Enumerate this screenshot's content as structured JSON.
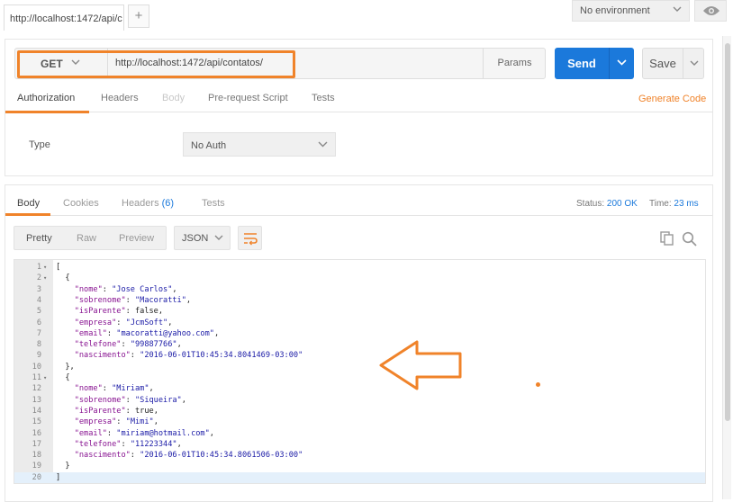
{
  "tabs": {
    "active_label": "http://localhost:1472/api/c",
    "add_label": "+"
  },
  "environment": {
    "selected": "No environment"
  },
  "request": {
    "method": "GET",
    "url": "http://localhost:1472/api/contatos/",
    "params_label": "Params",
    "send_label": "Send",
    "save_label": "Save",
    "tabs": [
      "Authorization",
      "Headers",
      "Body",
      "Pre-request Script",
      "Tests"
    ],
    "generate_code_label": "Generate Code",
    "auth": {
      "type_label": "Type",
      "selected": "No Auth"
    }
  },
  "response": {
    "tabs": {
      "body": "Body",
      "cookies": "Cookies",
      "headers": "Headers",
      "headers_count": "(6)",
      "tests": "Tests"
    },
    "status_label": "Status:",
    "status_value": "200 OK",
    "time_label": "Time:",
    "time_value": "23 ms",
    "view_modes": [
      "Pretty",
      "Raw",
      "Preview"
    ],
    "format": "JSON",
    "lines": [
      {
        "n": "1",
        "fold": "▾",
        "parts": [
          [
            "p",
            "["
          ]
        ]
      },
      {
        "n": "2",
        "fold": "▾",
        "parts": [
          [
            "p",
            "  {"
          ]
        ]
      },
      {
        "n": "3",
        "fold": "",
        "parts": [
          [
            "p",
            "    "
          ],
          [
            "k",
            "\"nome\""
          ],
          [
            "p",
            ": "
          ],
          [
            "s",
            "\"Jose Carlos\""
          ],
          [
            "p",
            ","
          ]
        ]
      },
      {
        "n": "4",
        "fold": "",
        "parts": [
          [
            "p",
            "    "
          ],
          [
            "k",
            "\"sobrenome\""
          ],
          [
            "p",
            ": "
          ],
          [
            "s",
            "\"Macoratti\""
          ],
          [
            "p",
            ","
          ]
        ]
      },
      {
        "n": "5",
        "fold": "",
        "parts": [
          [
            "p",
            "    "
          ],
          [
            "k",
            "\"isParente\""
          ],
          [
            "p",
            ": "
          ],
          [
            "l",
            "false"
          ],
          [
            "p",
            ","
          ]
        ]
      },
      {
        "n": "6",
        "fold": "",
        "parts": [
          [
            "p",
            "    "
          ],
          [
            "k",
            "\"empresa\""
          ],
          [
            "p",
            ": "
          ],
          [
            "s",
            "\"JcmSoft\""
          ],
          [
            "p",
            ","
          ]
        ]
      },
      {
        "n": "7",
        "fold": "",
        "parts": [
          [
            "p",
            "    "
          ],
          [
            "k",
            "\"email\""
          ],
          [
            "p",
            ": "
          ],
          [
            "s",
            "\"macoratti@yahoo.com\""
          ],
          [
            "p",
            ","
          ]
        ]
      },
      {
        "n": "8",
        "fold": "",
        "parts": [
          [
            "p",
            "    "
          ],
          [
            "k",
            "\"telefone\""
          ],
          [
            "p",
            ": "
          ],
          [
            "s",
            "\"99887766\""
          ],
          [
            "p",
            ","
          ]
        ]
      },
      {
        "n": "9",
        "fold": "",
        "parts": [
          [
            "p",
            "    "
          ],
          [
            "k",
            "\"nascimento\""
          ],
          [
            "p",
            ": "
          ],
          [
            "s",
            "\"2016-06-01T10:45:34.8041469-03:00\""
          ]
        ]
      },
      {
        "n": "10",
        "fold": "",
        "parts": [
          [
            "p",
            "  },"
          ]
        ]
      },
      {
        "n": "11",
        "fold": "▾",
        "parts": [
          [
            "p",
            "  {"
          ]
        ]
      },
      {
        "n": "12",
        "fold": "",
        "parts": [
          [
            "p",
            "    "
          ],
          [
            "k",
            "\"nome\""
          ],
          [
            "p",
            ": "
          ],
          [
            "s",
            "\"Miriam\""
          ],
          [
            "p",
            ","
          ]
        ]
      },
      {
        "n": "13",
        "fold": "",
        "parts": [
          [
            "p",
            "    "
          ],
          [
            "k",
            "\"sobrenome\""
          ],
          [
            "p",
            ": "
          ],
          [
            "s",
            "\"Siqueira\""
          ],
          [
            "p",
            ","
          ]
        ]
      },
      {
        "n": "14",
        "fold": "",
        "parts": [
          [
            "p",
            "    "
          ],
          [
            "k",
            "\"isParente\""
          ],
          [
            "p",
            ": "
          ],
          [
            "l",
            "true"
          ],
          [
            "p",
            ","
          ]
        ]
      },
      {
        "n": "15",
        "fold": "",
        "parts": [
          [
            "p",
            "    "
          ],
          [
            "k",
            "\"empresa\""
          ],
          [
            "p",
            ": "
          ],
          [
            "s",
            "\"Mimi\""
          ],
          [
            "p",
            ","
          ]
        ]
      },
      {
        "n": "16",
        "fold": "",
        "parts": [
          [
            "p",
            "    "
          ],
          [
            "k",
            "\"email\""
          ],
          [
            "p",
            ": "
          ],
          [
            "s",
            "\"miriam@hotmail.com\""
          ],
          [
            "p",
            ","
          ]
        ]
      },
      {
        "n": "17",
        "fold": "",
        "parts": [
          [
            "p",
            "    "
          ],
          [
            "k",
            "\"telefone\""
          ],
          [
            "p",
            ": "
          ],
          [
            "s",
            "\"11223344\""
          ],
          [
            "p",
            ","
          ]
        ]
      },
      {
        "n": "18",
        "fold": "",
        "parts": [
          [
            "p",
            "    "
          ],
          [
            "k",
            "\"nascimento\""
          ],
          [
            "p",
            ": "
          ],
          [
            "s",
            "\"2016-06-01T10:45:34.8061506-03:00\""
          ]
        ]
      },
      {
        "n": "19",
        "fold": "",
        "parts": [
          [
            "p",
            "  }"
          ]
        ]
      },
      {
        "n": "20",
        "fold": "",
        "parts": [
          [
            "p",
            "]"
          ]
        ]
      }
    ]
  },
  "icons": {
    "chevron": "chevron-down-icon",
    "eye": "eye-icon",
    "wrap": "wrap-lines-icon",
    "copy": "copy-icon",
    "search": "search-icon",
    "annotation": "left-arrow-annotation-icon"
  },
  "colors": {
    "accent": "#f0832a",
    "send": "#1b79db",
    "link": "#1b79db"
  }
}
